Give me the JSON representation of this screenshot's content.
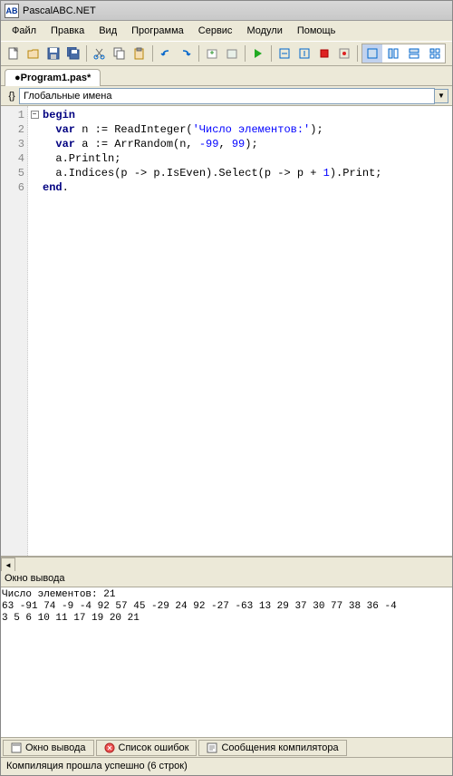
{
  "titlebar": {
    "title": "PascalABC.NET"
  },
  "menu": {
    "file": "Файл",
    "edit": "Правка",
    "view": "Вид",
    "program": "Программа",
    "service": "Сервис",
    "modules": "Модули",
    "help": "Помощь"
  },
  "tab": {
    "name": "●Program1.pas*"
  },
  "scope": {
    "label": "Глобальные имена"
  },
  "code": {
    "lines": [
      "1",
      "2",
      "3",
      "4",
      "5",
      "6"
    ],
    "l1_kw": "begin",
    "l2_pre": "  ",
    "l2_kw": "var",
    "l2_a": " n := ReadInteger(",
    "l2_str": "'Число элементов:'",
    "l2_b": ");",
    "l3_pre": "  ",
    "l3_kw": "var",
    "l3_a": " a := ArrRandom(n, ",
    "l3_n1": "-99",
    "l3_b": ", ",
    "l3_n2": "99",
    "l3_c": ");",
    "l4": "  a.Println;",
    "l5_a": "  a.Indices(p -> p.IsEven).Select(p -> p + ",
    "l5_n": "1",
    "l5_b": ").Print;",
    "l6_kw": "end",
    "l6_dot": "."
  },
  "output": {
    "title": "Окно вывода",
    "text": "Число элементов: 21\n63 -91 74 -9 -4 92 57 45 -29 24 92 -27 -63 13 29 37 30 77 38 36 -4\n3 5 6 10 11 17 19 20 21"
  },
  "bottom_tabs": {
    "output": "Окно вывода",
    "errors": "Список ошибок",
    "compiler": "Сообщения компилятора"
  },
  "status": {
    "text": "Компиляция прошла успешно (6 строк)"
  }
}
